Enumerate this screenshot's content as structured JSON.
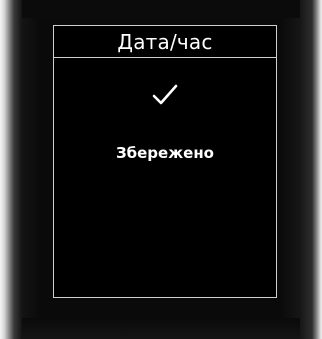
{
  "screen": {
    "title": "Дата/час",
    "confirmation_icon": "checkmark-icon",
    "status_text": "Збережено"
  },
  "colors": {
    "screen_background": "#000000",
    "text": "#ffffff",
    "border": "#cfcfcf"
  }
}
